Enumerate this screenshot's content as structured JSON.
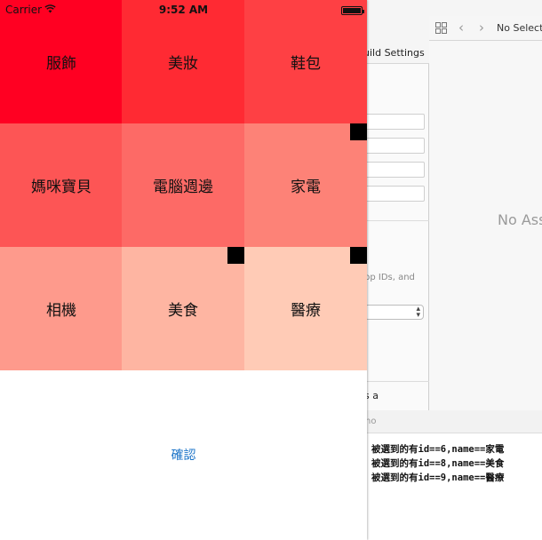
{
  "status_bar": {
    "carrier": "Carrier",
    "time": "9:52 AM"
  },
  "grid": {
    "cells": [
      {
        "label": "服飾",
        "color": "#ff0022",
        "selected": false
      },
      {
        "label": "美妝",
        "color": "#ff2a33",
        "selected": false
      },
      {
        "label": "鞋包",
        "color": "#fe4044",
        "selected": false
      },
      {
        "label": "媽咪寶貝",
        "color": "#fd5555",
        "selected": false
      },
      {
        "label": "電腦週邊",
        "color": "#fd6a66",
        "selected": false
      },
      {
        "label": "家電",
        "color": "#fd8277",
        "selected": true
      },
      {
        "label": "相機",
        "color": "#fe9a8c",
        "selected": false
      },
      {
        "label": "美食",
        "color": "#feb5a2",
        "selected": true
      },
      {
        "label": "醫療",
        "color": "#ffcbb6",
        "selected": true
      }
    ]
  },
  "confirm_label": "確認",
  "xcode": {
    "tab_label": "uild Settings",
    "hint_text": "pp IDs, and",
    "bottom_text": "s a",
    "nav_title": "No Select",
    "empty_text": "No Ass",
    "console_header": "no",
    "console_lines": [
      "被選到的有id==6,name==家電",
      "被選到的有id==8,name==美食",
      "被選到的有id==9,name==醫療"
    ]
  }
}
